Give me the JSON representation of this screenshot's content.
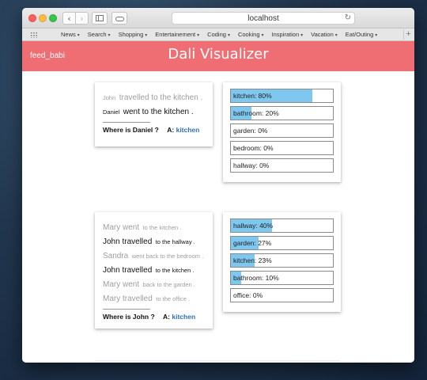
{
  "browser": {
    "url": "localhost",
    "favorites": [
      {
        "label": "News"
      },
      {
        "label": "Search"
      },
      {
        "label": "Shopping"
      },
      {
        "label": "Entertainement"
      },
      {
        "label": "Coding"
      },
      {
        "label": "Cooking"
      },
      {
        "label": "Inspiration"
      },
      {
        "label": "Vacation"
      },
      {
        "label": "Eat/Outing"
      }
    ]
  },
  "app": {
    "brand": "feed_babi",
    "title": "Dali Visualizer"
  },
  "examples": [
    {
      "story": [
        {
          "subject": "John",
          "rest": "travelled to the kitchen .",
          "style": "faded"
        },
        {
          "subject": "Daniel",
          "rest": "went to the kitchen .",
          "style": "active"
        }
      ],
      "question": "Where is Daniel ?",
      "answer_label": "A:",
      "answer": "kitchen",
      "memory": [
        {
          "label": "kitchen: 80%",
          "value": 0.8
        },
        {
          "label": "bathroom: 20%",
          "value": 0.2
        },
        {
          "label": "garden: 0%",
          "value": 0.0
        },
        {
          "label": "bedroom: 0%",
          "value": 0.0
        },
        {
          "label": "hallway: 0%",
          "value": 0.0
        }
      ]
    },
    {
      "story": [
        {
          "subject": "Mary went",
          "rest": "to the kitchen .",
          "style": "faded"
        },
        {
          "subject": "John travelled",
          "rest": "to the hallway .",
          "style": "active"
        },
        {
          "subject": "Sandra",
          "rest": "went back to the bedroom .",
          "style": "faded"
        },
        {
          "subject": "John travelled",
          "rest": "to the kitchen .",
          "style": "active"
        },
        {
          "subject": "Mary went",
          "rest": "back to the garden .",
          "style": "faded"
        },
        {
          "subject": "Mary travelled",
          "rest": "to the office .",
          "style": "faded"
        }
      ],
      "question": "Where is John ?",
      "answer_label": "A:",
      "answer": "kitchen",
      "memory": [
        {
          "label": "hallway: 40%",
          "value": 0.4
        },
        {
          "label": "garden: 27%",
          "value": 0.27
        },
        {
          "label": "kitchen: 23%",
          "value": 0.23
        },
        {
          "label": "bathroom: 10%",
          "value": 0.1
        },
        {
          "label": "office: 0%",
          "value": 0.0
        }
      ]
    }
  ],
  "colors": {
    "header": "#ee6e73",
    "bar_fill": "#7ec8f0",
    "answer": "#2e6fb6"
  }
}
